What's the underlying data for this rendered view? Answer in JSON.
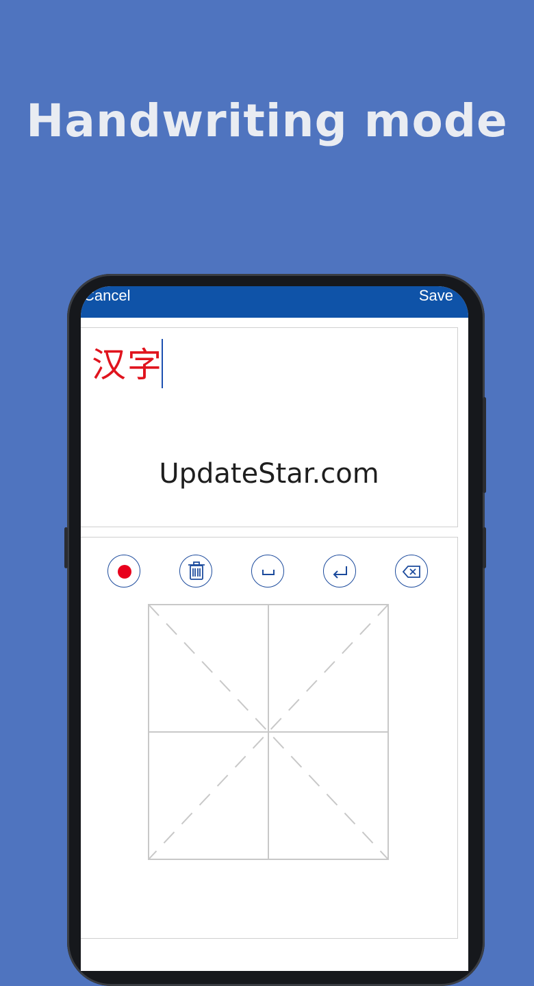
{
  "headline": "Handwriting mode",
  "topbar": {
    "cancel_label": "Cancel",
    "save_label": "Save"
  },
  "editor": {
    "handwritten_text": "汉字",
    "watermark": "UpdateStar.com"
  },
  "toolbar": {
    "buttons": [
      {
        "name": "record-button",
        "icon": "record-icon"
      },
      {
        "name": "clear-button",
        "icon": "trash-icon"
      },
      {
        "name": "space-button",
        "icon": "space-icon"
      },
      {
        "name": "enter-button",
        "icon": "enter-icon"
      },
      {
        "name": "backspace-button",
        "icon": "backspace-icon"
      }
    ]
  },
  "colors": {
    "background": "#4f74bf",
    "topbar": "#0f53a8",
    "ink": "#e0141e",
    "icon": "#1b4a9c"
  }
}
